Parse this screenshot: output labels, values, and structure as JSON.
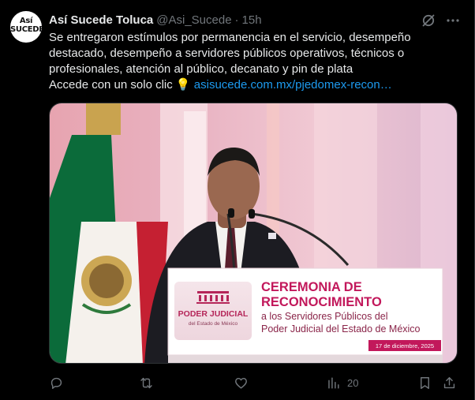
{
  "tweet": {
    "avatar_line1": "Así",
    "avatar_line2": "SUCEDE",
    "display_name": "Así Sucede Toluca",
    "handle": "@Asi_Sucede",
    "separator": "·",
    "time": "15h",
    "text_lines": [
      "Se entregaron estímulos por permanencia en el servicio, desempeño",
      "destacado, desempeño a servidores públicos operativos, técnicos o",
      "profesionales, atención al público, decanato y pin de plata"
    ],
    "cta_text": "Accede con un solo clic ",
    "cta_emoji": "💡",
    "link_text": "asisucede.com.mx/pjedomex-recon…"
  },
  "media": {
    "banner_title_1": "CEREMONIA DE",
    "banner_title_2": "RECONOCIMIENTO",
    "banner_sub_1": "a los Servidores Públicos del",
    "banner_sub_2": "Poder Judicial del Estado de México",
    "banner_date": "17 de diciembre, 2025",
    "logo_title": "PODER JUDICIAL",
    "logo_sub": "del Estado de México"
  },
  "actions": {
    "reply_count": "",
    "repost_count": "",
    "like_count": "",
    "views_count": "20"
  },
  "colors": {
    "background": "#000000",
    "text": "#e7e9ea",
    "muted": "#71767b",
    "link": "#1d9bf0",
    "banner_magenta": "#c2185b"
  }
}
